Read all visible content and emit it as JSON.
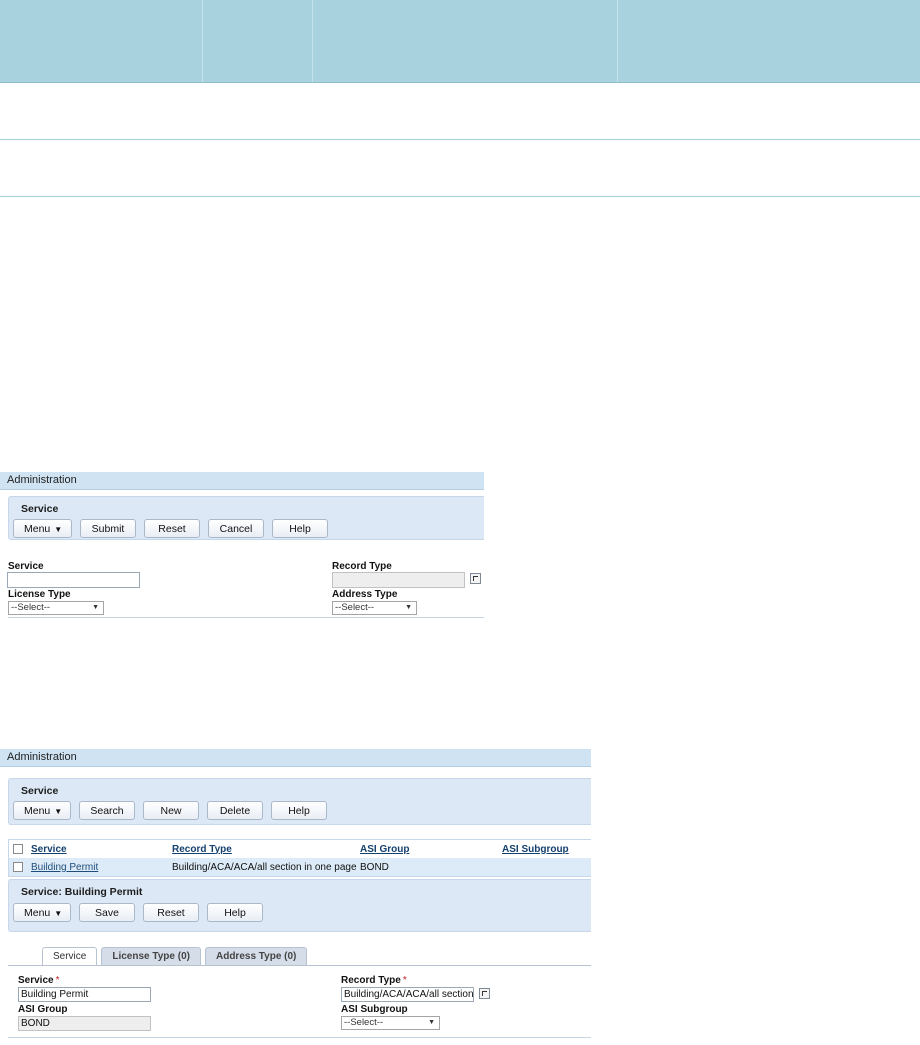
{
  "panel1": {
    "admin_title": "Administration",
    "section_title": "Service",
    "buttons": {
      "menu": "Menu",
      "submit": "Submit",
      "reset": "Reset",
      "cancel": "Cancel",
      "help": "Help"
    },
    "fields": {
      "service_label": "Service",
      "service_value": "",
      "record_type_label": "Record Type",
      "record_type_value": "",
      "license_type_label": "License Type",
      "license_type_value": "--Select--",
      "address_type_label": "Address Type",
      "address_type_value": "--Select--"
    }
  },
  "panel2": {
    "admin_title": "Administration",
    "section_title": "Service",
    "buttons": {
      "menu": "Menu",
      "search": "Search",
      "new": "New",
      "delete": "Delete",
      "help": "Help"
    },
    "list": {
      "columns": [
        "Service",
        "Record Type",
        "ASI Group",
        "ASI Subgroup"
      ],
      "rows": [
        {
          "service": "Building Permit",
          "record_type": "Building/ACA/ACA/all section in one page",
          "asi_group": "BOND",
          "asi_subgroup": ""
        }
      ]
    },
    "detail": {
      "section_title": "Service: Building Permit",
      "buttons": {
        "menu": "Menu",
        "save": "Save",
        "reset": "Reset",
        "help": "Help"
      },
      "tabs": [
        "Service",
        "License Type (0)",
        "Address Type (0)"
      ],
      "fields": {
        "service_label": "Service",
        "service_value": "Building Permit",
        "record_type_label": "Record Type",
        "record_type_value": "Building/ACA/ACA/all section in one page",
        "asi_group_label": "ASI Group",
        "asi_group_value": "BOND",
        "asi_subgroup_label": "ASI Subgroup",
        "asi_subgroup_value": "--Select--"
      }
    }
  },
  "colors": {
    "header_blue": "#a8d2de",
    "admin_bar": "#cfe3f3",
    "section_bg": "#dce8f5",
    "link": "#14406e"
  },
  "icons": [
    "dropdown-arrow-icon",
    "record-type-picker-icon",
    "menu-arrow-icon"
  ]
}
